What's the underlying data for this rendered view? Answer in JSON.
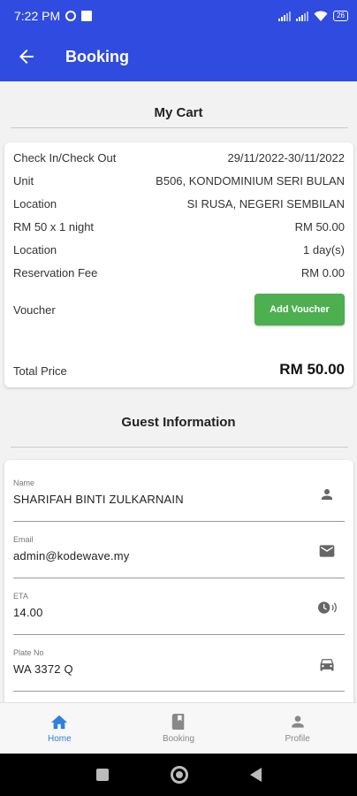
{
  "status_bar": {
    "time": "7:22 PM",
    "battery": "26"
  },
  "appbar": {
    "title": "Booking"
  },
  "cart": {
    "title": "My Cart",
    "rows": [
      {
        "label": "Check In/Check Out",
        "value": "29/11/2022-30/11/2022"
      },
      {
        "label": "Unit",
        "value": "B506, KONDOMINIUM SERI BULAN"
      },
      {
        "label": "Location",
        "value": "SI RUSA, NEGERI SEMBILAN"
      },
      {
        "label": "RM 50 x 1 night",
        "value": "RM 50.00"
      },
      {
        "label": "Location",
        "value": "1 day(s)"
      },
      {
        "label": "Reservation Fee",
        "value": "RM 0.00"
      }
    ],
    "voucher_label": "Voucher",
    "voucher_button": "Add Voucher",
    "total_label": "Total Price",
    "total_value": "RM 50.00"
  },
  "guest": {
    "title": "Guest Information",
    "fields": [
      {
        "label": "Name",
        "value": "SHARIFAH BINTI ZULKARNAIN",
        "icon": "person-icon"
      },
      {
        "label": "Email",
        "value": "admin@kodewave.my",
        "icon": "email-icon"
      },
      {
        "label": "ETA",
        "value": "14.00",
        "icon": "clock-icon"
      },
      {
        "label": "Plate No",
        "value": "WA 3372 Q",
        "icon": "car-icon"
      }
    ]
  },
  "bottom_nav": [
    {
      "label": "Home",
      "icon": "home-icon",
      "active": true
    },
    {
      "label": "Booking",
      "icon": "book-icon",
      "active": false
    },
    {
      "label": "Profile",
      "icon": "person-icon",
      "active": false
    }
  ],
  "colors": {
    "primary": "#2f4be0",
    "voucher_button": "#4caf50",
    "nav_active": "#2d7fe0"
  }
}
